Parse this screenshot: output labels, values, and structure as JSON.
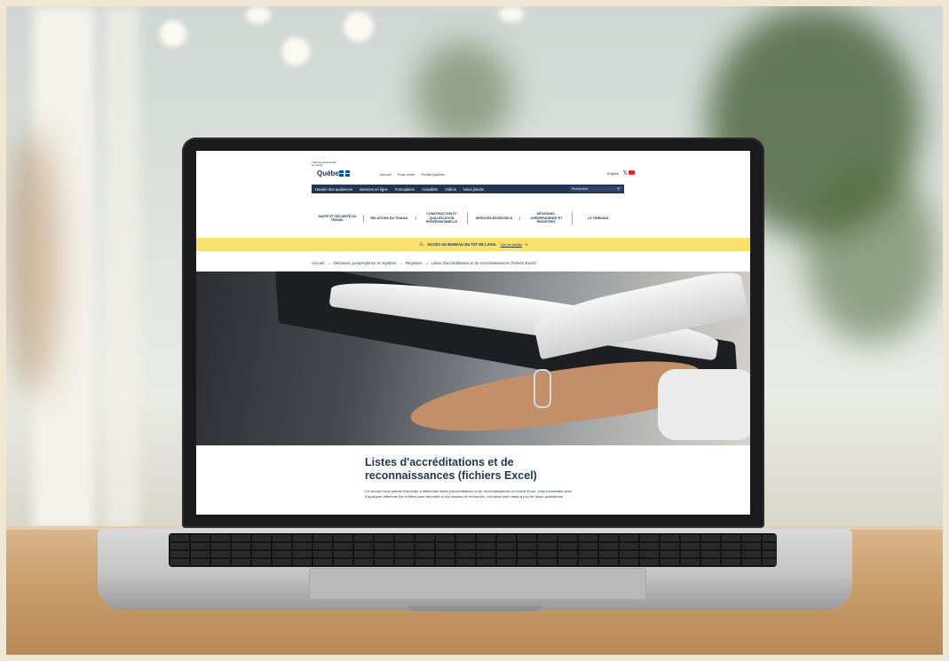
{
  "site": {
    "logo": {
      "org_name": "Tribunal administratif du travail",
      "wordmark": "Québec"
    },
    "top_links": [
      "Accueil",
      "Pour écrire",
      "Portail Québec"
    ],
    "language_link": "English",
    "social": [
      "x-icon",
      "youtube-icon"
    ],
    "utility_nav": [
      "Horaire des audiences",
      "Services en ligne",
      "Formulaires",
      "Actualités",
      "Vidéos",
      "Nous joindre"
    ],
    "search_placeholder": "Rechercher",
    "main_nav": [
      "SANTÉ ET SÉCURITÉ DU TRAVAIL",
      "RELATIONS DU TRAVAIL",
      "CONSTRUCTION ET QUALIFICATION PROFESSIONNELLE",
      "SERVICES ESSENTIELS",
      "DÉCISIONS, JURISPRUDENCE ET REGISTRES",
      "LE TRIBUNAL"
    ],
    "alert": {
      "message": "ACCÈS AU BUREAU DU TAT DE LAVAL",
      "link": "Voir les détails"
    },
    "breadcrumb": [
      "Accueil",
      "Décisions, jurisprudence et registres",
      "Registres",
      "Listes d'accréditations et de reconnaissances (fichiers Excel)"
    ],
    "page_title": "Listes d'accréditations et de reconnaissances (fichiers Excel)",
    "intro": "Ce service vous permet d'accéder à différentes listes d'accréditations et de reconnaissances en format Excel, vous permettant ainsi d'appliquer différents tris et filtres pour répondre à vos besoins de recherche. Les listes sont mises à jour de façon quotidienne."
  },
  "colors": {
    "brand_navy": "#223654",
    "alert_yellow": "#f8e16c",
    "flag_blue": "#095797",
    "youtube_red": "#e1251b"
  }
}
